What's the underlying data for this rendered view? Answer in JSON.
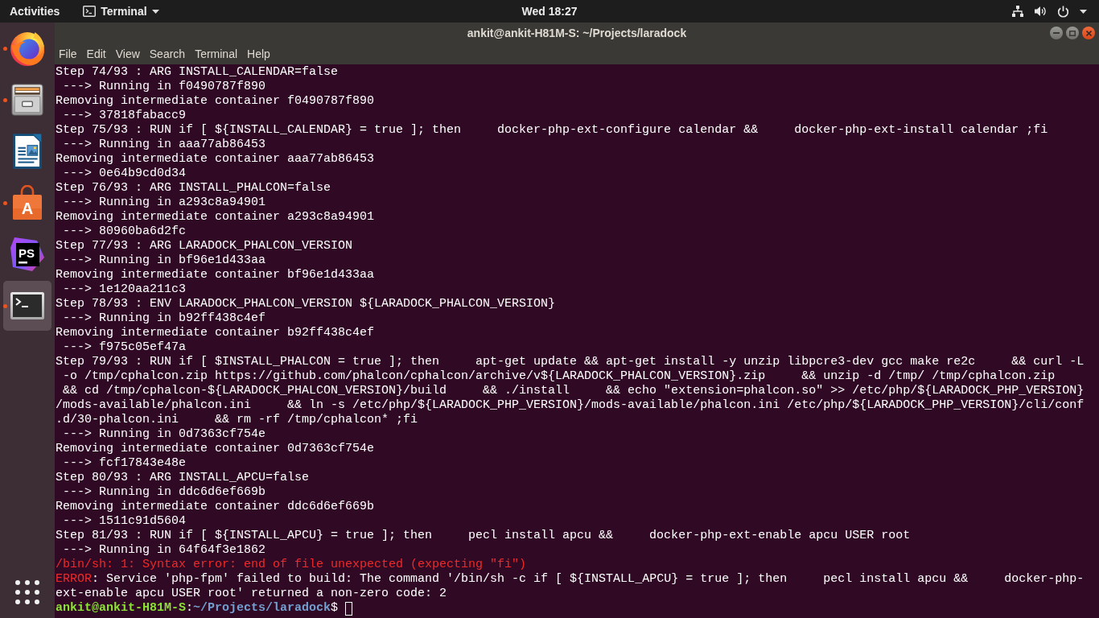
{
  "top_bar": {
    "activities": "Activities",
    "app_menu": "Terminal",
    "clock": "Wed 18:27"
  },
  "dock": {
    "items": [
      {
        "kind": "browser",
        "running": true,
        "selected": false
      },
      {
        "kind": "files",
        "running": true,
        "selected": false
      },
      {
        "kind": "writer",
        "running": false,
        "selected": false
      },
      {
        "kind": "software",
        "label": "A",
        "running": true,
        "selected": false
      },
      {
        "kind": "ide",
        "label": "PS",
        "running": false,
        "selected": false
      },
      {
        "kind": "terminal",
        "running": true,
        "selected": true
      }
    ]
  },
  "window": {
    "title": "ankit@ankit-H81M-S: ~/Projects/laradock",
    "menu": [
      "File",
      "Edit",
      "View",
      "Search",
      "Terminal",
      "Help"
    ]
  },
  "terminal": {
    "lines": [
      {
        "kind": "plain",
        "text": "Step 74/93 : ARG INSTALL_CALENDAR=false"
      },
      {
        "kind": "plain",
        "text": " ---> Running in f0490787f890"
      },
      {
        "kind": "plain",
        "text": "Removing intermediate container f0490787f890"
      },
      {
        "kind": "plain",
        "text": " ---> 37818fabacc9"
      },
      {
        "kind": "plain",
        "text": "Step 75/93 : RUN if [ ${INSTALL_CALENDAR} = true ]; then     docker-php-ext-configure calendar &&     docker-php-ext-install calendar ;fi"
      },
      {
        "kind": "plain",
        "text": " ---> Running in aaa77ab86453"
      },
      {
        "kind": "plain",
        "text": "Removing intermediate container aaa77ab86453"
      },
      {
        "kind": "plain",
        "text": " ---> 0e64b9cd0d34"
      },
      {
        "kind": "plain",
        "text": "Step 76/93 : ARG INSTALL_PHALCON=false"
      },
      {
        "kind": "plain",
        "text": " ---> Running in a293c8a94901"
      },
      {
        "kind": "plain",
        "text": "Removing intermediate container a293c8a94901"
      },
      {
        "kind": "plain",
        "text": " ---> 80960ba6d2fc"
      },
      {
        "kind": "plain",
        "text": "Step 77/93 : ARG LARADOCK_PHALCON_VERSION"
      },
      {
        "kind": "plain",
        "text": " ---> Running in bf96e1d433aa"
      },
      {
        "kind": "plain",
        "text": "Removing intermediate container bf96e1d433aa"
      },
      {
        "kind": "plain",
        "text": " ---> 1e120aa211c3"
      },
      {
        "kind": "plain",
        "text": "Step 78/93 : ENV LARADOCK_PHALCON_VERSION ${LARADOCK_PHALCON_VERSION}"
      },
      {
        "kind": "plain",
        "text": " ---> Running in b92ff438c4ef"
      },
      {
        "kind": "plain",
        "text": "Removing intermediate container b92ff438c4ef"
      },
      {
        "kind": "plain",
        "text": " ---> f975c05ef47a"
      },
      {
        "kind": "plain",
        "text": "Step 79/93 : RUN if [ $INSTALL_PHALCON = true ]; then     apt-get update && apt-get install -y unzip libpcre3-dev gcc make re2c     && curl -L"
      },
      {
        "kind": "plain",
        "text": " -o /tmp/cphalcon.zip https://github.com/phalcon/cphalcon/archive/v${LARADOCK_PHALCON_VERSION}.zip     && unzip -d /tmp/ /tmp/cphalcon.zip"
      },
      {
        "kind": "plain",
        "text": " && cd /tmp/cphalcon-${LARADOCK_PHALCON_VERSION}/build     && ./install     && echo \"extension=phalcon.so\" >> /etc/php/${LARADOCK_PHP_VERSION}"
      },
      {
        "kind": "plain",
        "text": "/mods-available/phalcon.ini     && ln -s /etc/php/${LARADOCK_PHP_VERSION}/mods-available/phalcon.ini /etc/php/${LARADOCK_PHP_VERSION}/cli/conf"
      },
      {
        "kind": "plain",
        "text": ".d/30-phalcon.ini     && rm -rf /tmp/cphalcon* ;fi"
      },
      {
        "kind": "plain",
        "text": " ---> Running in 0d7363cf754e"
      },
      {
        "kind": "plain",
        "text": "Removing intermediate container 0d7363cf754e"
      },
      {
        "kind": "plain",
        "text": " ---> fcf17843e48e"
      },
      {
        "kind": "plain",
        "text": "Step 80/93 : ARG INSTALL_APCU=false"
      },
      {
        "kind": "plain",
        "text": " ---> Running in ddc6d6ef669b"
      },
      {
        "kind": "plain",
        "text": "Removing intermediate container ddc6d6ef669b"
      },
      {
        "kind": "plain",
        "text": " ---> 1511c91d5604"
      },
      {
        "kind": "plain",
        "text": "Step 81/93 : RUN if [ ${INSTALL_APCU} = true ]; then     pecl install apcu &&     docker-php-ext-enable apcu USER root"
      },
      {
        "kind": "plain",
        "text": " ---> Running in 64f64f3e1862"
      },
      {
        "kind": "error",
        "text": "/bin/sh: 1: Syntax error: end of file unexpected (expecting \"fi\")"
      },
      {
        "segments": [
          {
            "kind": "error",
            "text": "ERROR"
          },
          {
            "kind": "plain",
            "text": ": Service 'php-fpm' failed to build: The command '/bin/sh -c if [ ${INSTALL_APCU} = true ]; then     pecl install apcu &&     docker-php-"
          }
        ]
      },
      {
        "kind": "plain",
        "text": "ext-enable apcu USER root' returned a non-zero code: 2"
      }
    ],
    "prompt": {
      "user_host": "ankit@ankit-H81M-S",
      "separator": ":",
      "path": "~/Projects/laradock",
      "symbol": "$"
    }
  }
}
